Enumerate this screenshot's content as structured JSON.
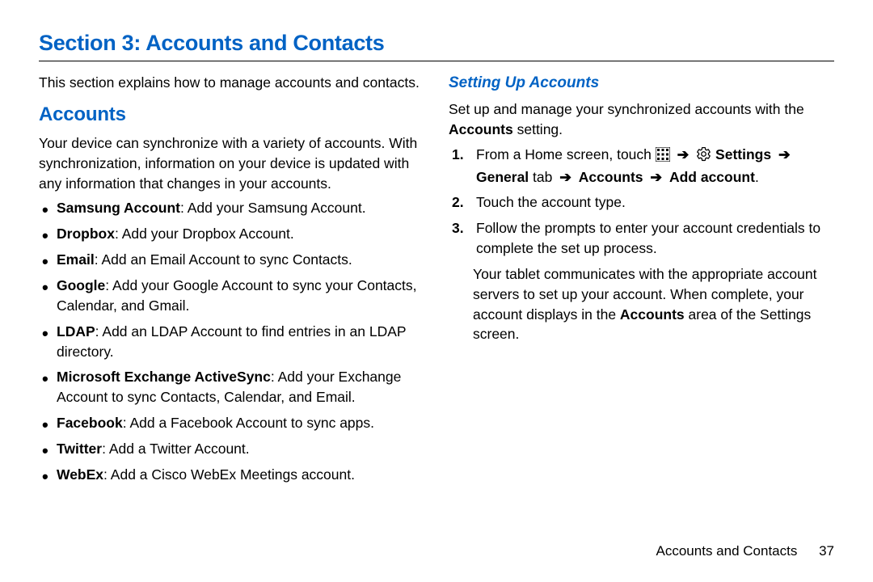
{
  "section_title": "Section 3: Accounts and Contacts",
  "left": {
    "intro": "This section explains how to manage accounts and contacts.",
    "heading": "Accounts",
    "para": "Your device can synchronize with a variety of accounts. With synchronization, information on your device is updated with any information that changes in your accounts.",
    "items": [
      {
        "term": "Samsung Account",
        "desc": ": Add your Samsung Account."
      },
      {
        "term": "Dropbox",
        "desc": ": Add your Dropbox Account."
      },
      {
        "term": "Email",
        "desc": ": Add an Email Account to sync Contacts."
      },
      {
        "term": "Google",
        "desc": ": Add your Google Account to sync your Contacts, Calendar, and Gmail."
      },
      {
        "term": "LDAP",
        "desc": ": Add an LDAP Account to find entries in an LDAP directory."
      },
      {
        "term": "Microsoft Exchange ActiveSync",
        "desc": ": Add your Exchange Account to sync Contacts, Calendar, and Email."
      },
      {
        "term": "Facebook",
        "desc": ": Add a Facebook Account to sync apps."
      },
      {
        "term": "Twitter",
        "desc": ": Add a Twitter Account."
      },
      {
        "term": "WebEx",
        "desc": ": Add a Cisco WebEx Meetings account."
      }
    ]
  },
  "right": {
    "heading": "Setting Up Accounts",
    "para_pre": "Set up and manage your synchronized accounts with the ",
    "para_bold": "Accounts",
    "para_post": " setting.",
    "step1_pre": "From a Home screen, touch ",
    "step1_settings": "Settings",
    "step1_general": "General",
    "step1_tab": " tab ",
    "step1_accounts": "Accounts",
    "step1_add": "Add account",
    "step2": "Touch the account type.",
    "step3": "Follow the prompts to enter your account credentials to complete the set up process.",
    "after_pre": "Your tablet communicates with the appropriate account servers to set up your account. When complete, your account displays in the ",
    "after_bold": "Accounts",
    "after_post": " area of the Settings screen."
  },
  "footer": {
    "label": "Accounts and Contacts",
    "page": "37"
  },
  "glyphs": {
    "arrow": "➔"
  }
}
